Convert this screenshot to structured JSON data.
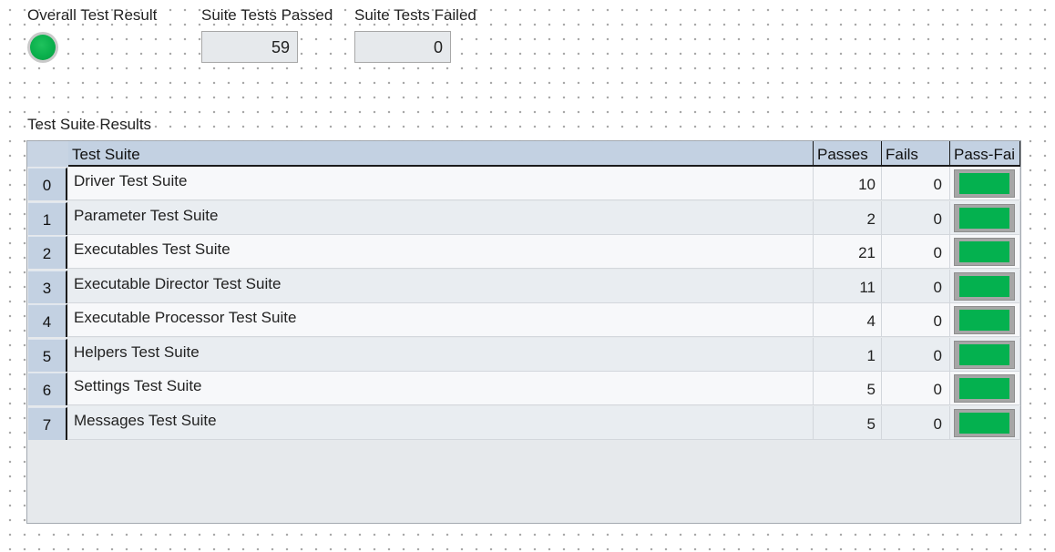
{
  "overall": {
    "label": "Overall Test Result",
    "status": "pass",
    "led_color": "#0ab04c"
  },
  "passed": {
    "label": "Suite Tests Passed",
    "value": "59"
  },
  "failed": {
    "label": "Suite Tests Failed",
    "value": "0"
  },
  "table": {
    "label": "Test Suite Results",
    "columns": [
      "Test Suite",
      "Passes",
      "Fails",
      "Pass-Fai"
    ],
    "rows": [
      {
        "index": "0",
        "name": "Driver Test Suite",
        "passes": "10",
        "fails": "0",
        "pass_fail": "pass"
      },
      {
        "index": "1",
        "name": "Parameter Test Suite",
        "passes": "2",
        "fails": "0",
        "pass_fail": "pass"
      },
      {
        "index": "2",
        "name": "Executables Test Suite",
        "passes": "21",
        "fails": "0",
        "pass_fail": "pass"
      },
      {
        "index": "3",
        "name": "Executable Director Test Suite",
        "passes": "11",
        "fails": "0",
        "pass_fail": "pass"
      },
      {
        "index": "4",
        "name": "Executable Processor Test Suite",
        "passes": "4",
        "fails": "0",
        "pass_fail": "pass"
      },
      {
        "index": "5",
        "name": "Helpers Test Suite",
        "passes": "1",
        "fails": "0",
        "pass_fail": "pass"
      },
      {
        "index": "6",
        "name": "Settings Test Suite",
        "passes": "5",
        "fails": "0",
        "pass_fail": "pass"
      },
      {
        "index": "7",
        "name": "Messages Test Suite",
        "passes": "5",
        "fails": "0",
        "pass_fail": "pass"
      }
    ]
  },
  "colors": {
    "pass": "#04b14f",
    "header": "#c3d1e2",
    "row_light": "#f7f8fa",
    "row_dark": "#e9edf1"
  }
}
